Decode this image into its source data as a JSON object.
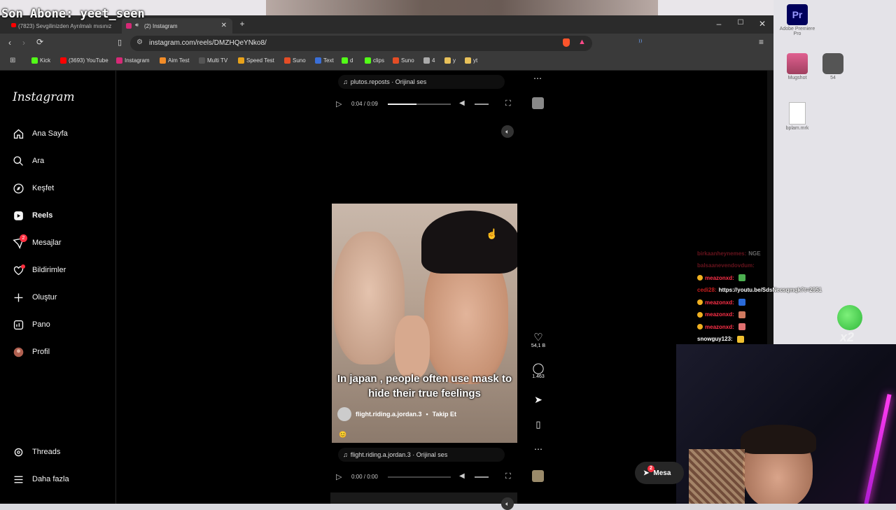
{
  "stream_overlay": {
    "last_subscriber": "Son Abone: yeet_seen"
  },
  "desktop": {
    "icons": [
      {
        "label": "Adobe Premiere Pro",
        "name": "premiere-icon"
      },
      {
        "label": "Mugshot",
        "name": "mugshot-icon"
      },
      {
        "label": "54",
        "name": "watch-icon"
      },
      {
        "label": "bplam.mrk",
        "name": "file-icon"
      }
    ]
  },
  "browser": {
    "tabs": [
      {
        "label": "(7823) Sevgilinizden Ayrılmalı mısınız",
        "active": false
      },
      {
        "label": "(2) Instagram",
        "active": true
      }
    ],
    "url": "instagram.com/reels/DMZHQeYNko8/",
    "bookmarks": [
      {
        "label": "Kick",
        "color": "#53fc18"
      },
      {
        "label": "(3693) YouTube",
        "color": "#ff0000"
      },
      {
        "label": "Instagram",
        "color": "#d62976"
      },
      {
        "label": "Aim Test",
        "color": "#f28c28"
      },
      {
        "label": "Multi TV",
        "color": "#555555"
      },
      {
        "label": "Speed Test",
        "color": "#e8a21a"
      },
      {
        "label": "Suno",
        "color": "#e44d26"
      },
      {
        "label": "Text",
        "color": "#3a6fd8"
      },
      {
        "label": "d",
        "color": "#53fc18"
      },
      {
        "label": "clips",
        "color": "#53fc18"
      },
      {
        "label": "Suno",
        "color": "#e44d26"
      },
      {
        "label": "4",
        "color": "#aaaaaa"
      },
      {
        "label": "y",
        "color": "#e8c15a"
      },
      {
        "label": "yt",
        "color": "#e8c15a"
      }
    ]
  },
  "instagram": {
    "logo": "Instagram",
    "nav": [
      {
        "label": "Ana Sayfa",
        "icon": "home-icon"
      },
      {
        "label": "Ara",
        "icon": "search-icon"
      },
      {
        "label": "Keşfet",
        "icon": "compass-icon"
      },
      {
        "label": "Reels",
        "icon": "reels-icon"
      },
      {
        "label": "Mesajlar",
        "icon": "messenger-icon",
        "badge": "2"
      },
      {
        "label": "Bildirimler",
        "icon": "heart-icon"
      },
      {
        "label": "Oluştur",
        "icon": "plus-icon"
      },
      {
        "label": "Pano",
        "icon": "dashboard-icon"
      },
      {
        "label": "Profil",
        "icon": "profile-avatar-icon"
      }
    ],
    "nav_bottom": [
      {
        "label": "Threads",
        "icon": "threads-icon"
      },
      {
        "label": "Daha fazla",
        "icon": "menu-icon"
      }
    ],
    "prev_post": {
      "audio": "plutos.reposts · Orijinal ses",
      "time": "0:04 / 0:09",
      "progress": 0.45
    },
    "reel": {
      "caption": "In japan , people often use mask to hide their true feelings",
      "author": "flight.riding.a.jordan.3",
      "follow": "Takip Et",
      "likes": "54,1 B",
      "comments": "1.463",
      "audio": "flight.riding.a.jordan.3 · Orijinal ses",
      "time": "0:00 / 0:00",
      "progress": 0
    },
    "messages_pill": {
      "label": "Mesa",
      "badge": "2"
    }
  },
  "chat": [
    {
      "user": "",
      "message": "",
      "faint": true
    },
    {
      "user": "birkaanheynemes:",
      "message": "NGE",
      "faint": true
    },
    {
      "user": "balsaanevendovdum:",
      "message": "",
      "faint": true
    },
    {
      "user": "meazonxd:",
      "message": "",
      "emote": "#4caf50"
    },
    {
      "user": "cedi28:",
      "message": "https://youtu.be/SdsNecsqmqk?t=2951"
    },
    {
      "user": "meazonxd:",
      "message": "",
      "emote": "#2a6ad8"
    },
    {
      "user": "meazonxd:",
      "message": "",
      "emote": "#d07a60"
    },
    {
      "user": "meazonxd:",
      "message": "",
      "emote": "#e07070"
    },
    {
      "user": "snowguy123:",
      "message": "",
      "emote": "#f0c030"
    }
  ]
}
